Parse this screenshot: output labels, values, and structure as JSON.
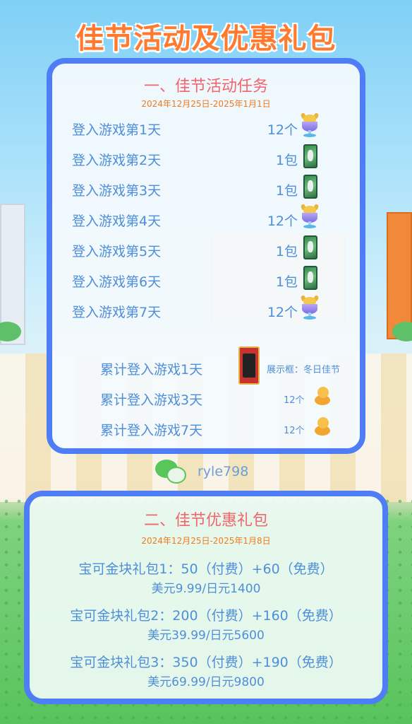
{
  "title": "佳节活动及优惠礼包",
  "section1": {
    "title": "一、佳节活动任务",
    "date": "2024年12月25日-2025年1月1日",
    "tasks": [
      {
        "label": "登入游戏第1天",
        "qty": "12个",
        "icon": "trophy-cup-icon"
      },
      {
        "label": "登入游戏第2天",
        "qty": "1包",
        "icon": "card-pack-icon"
      },
      {
        "label": "登入游戏第3天",
        "qty": "1包",
        "icon": "card-pack-icon"
      },
      {
        "label": "登入游戏第4天",
        "qty": "12个",
        "icon": "trophy-cup-icon"
      },
      {
        "label": "登入游戏第5天",
        "qty": "1包",
        "icon": "card-pack-icon"
      },
      {
        "label": "登入游戏第6天",
        "qty": "1包",
        "icon": "card-pack-icon"
      },
      {
        "label": "登入游戏第7天",
        "qty": "12个",
        "icon": "trophy-cup-icon"
      }
    ],
    "cumulative": [
      {
        "label": "累计登入游戏1天",
        "reward": "展示框：冬日佳节",
        "icon": "display-frame-icon"
      },
      {
        "label": "累计登入游戏3天",
        "reward": "12个",
        "icon": "gold-nugget-icon"
      },
      {
        "label": "累计登入游戏7天",
        "reward": "12个",
        "icon": "gold-nugget-icon"
      }
    ]
  },
  "watermark": {
    "text": "ryle798",
    "icon": "wechat-icon"
  },
  "section2": {
    "title": "二、佳节优惠礼包",
    "date": "2024年12月25日-2025年1月8日",
    "packs": [
      {
        "name": "宝可金块礼包1：50（付费）+60（免费）",
        "price": "美元9.99/日元1400"
      },
      {
        "name": "宝可金块礼包2：200（付费）+160（免费）",
        "price": "美元39.99/日元5600"
      },
      {
        "name": "宝可金块礼包3：350（付费）+190（免费）",
        "price": "美元69.99/日元9800"
      }
    ]
  },
  "colors": {
    "accent": "#4f7df5",
    "title": "#ff7a2e",
    "section_title": "#f2656c",
    "text": "#4f8ed9"
  }
}
